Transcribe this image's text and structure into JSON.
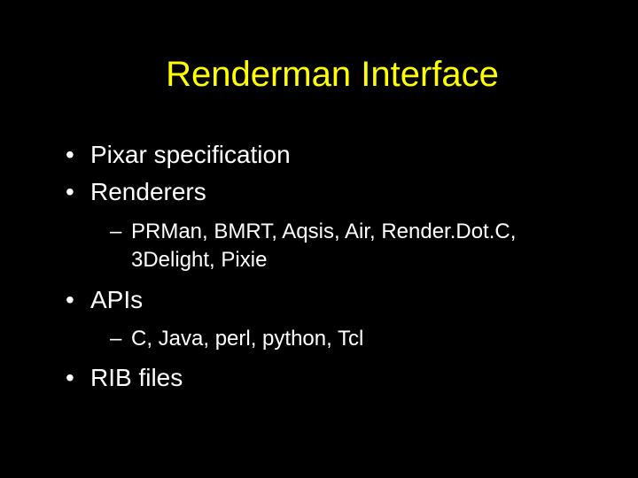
{
  "title": "Renderman Interface",
  "bullets": {
    "b0": "Pixar specification",
    "b1": "Renderers",
    "b1_sub0": "PRMan, BMRT, Aqsis, Air, Render.Dot.C, 3Delight, Pixie",
    "b2": "APIs",
    "b2_sub0": "C, Java, perl, python, Tcl",
    "b3": "RIB files"
  }
}
